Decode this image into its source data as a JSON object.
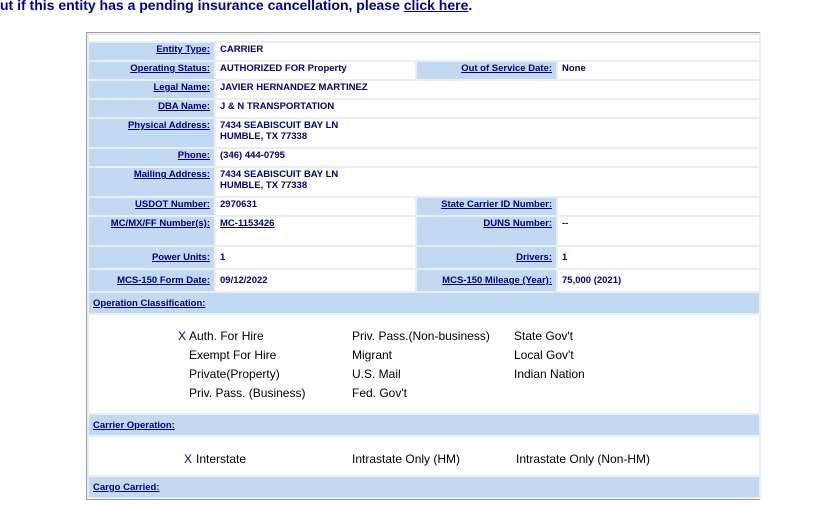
{
  "banner": {
    "text": "ut if this entity has a pending insurance cancellation, please ",
    "link": "click here",
    "end": "."
  },
  "rows": {
    "entity_type": {
      "label": "Entity Type:",
      "value": "CARRIER"
    },
    "operating_status": {
      "label": "Operating Status:",
      "value": "AUTHORIZED FOR Property"
    },
    "out_of_service": {
      "label": "Out of Service Date:",
      "value": "None"
    },
    "legal_name": {
      "label": "Legal Name:",
      "value": "JAVIER HERNANDEZ MARTINEZ"
    },
    "dba_name": {
      "label": "DBA Name:",
      "value": "J & N TRANSPORTATION"
    },
    "physical_address": {
      "label": "Physical Address:",
      "line1": "7434 SEABISCUIT BAY LN",
      "line2": "HUMBLE, TX   77338"
    },
    "phone": {
      "label": "Phone:",
      "value": "(346) 444-0795"
    },
    "mailing_address": {
      "label": "Mailing Address:",
      "line1": "7434 SEABISCUIT BAY LN",
      "line2": "HUMBLE, TX   77338"
    },
    "usdot": {
      "label": "USDOT Number:",
      "value": "2970631"
    },
    "state_carrier_id": {
      "label": "State Carrier ID Number:",
      "value": ""
    },
    "mc_number": {
      "label": "MC/MX/FF Number(s):",
      "value": "MC-1153426"
    },
    "duns": {
      "label": "DUNS Number:",
      "value": "--"
    },
    "power_units": {
      "label": "Power Units:",
      "value": "1"
    },
    "drivers": {
      "label": "Drivers:",
      "value": "1"
    },
    "mcs150_date": {
      "label": "MCS-150 Form Date:",
      "value": "09/12/2022"
    },
    "mcs150_mileage": {
      "label": "MCS-150 Mileage (Year):",
      "value": "75,000 (2021)"
    }
  },
  "operation_classification": {
    "label": "Operation Classification:",
    "mark": "X",
    "col1": [
      "Auth. For Hire",
      "Exempt For Hire",
      "Private(Property)",
      "Priv. Pass. (Business)"
    ],
    "col2": [
      "Priv. Pass.(Non-business)",
      "Migrant",
      "U.S. Mail",
      "Fed. Gov't"
    ],
    "col3": [
      "State Gov't",
      "Local Gov't",
      "Indian Nation"
    ]
  },
  "carrier_operation": {
    "label": "Carrier Operation:",
    "mark": "X",
    "items": [
      "Interstate",
      "Intrastate Only (HM)",
      "Intrastate Only (Non-HM)"
    ]
  },
  "cargo_carried": {
    "label": "Cargo Carried:"
  }
}
